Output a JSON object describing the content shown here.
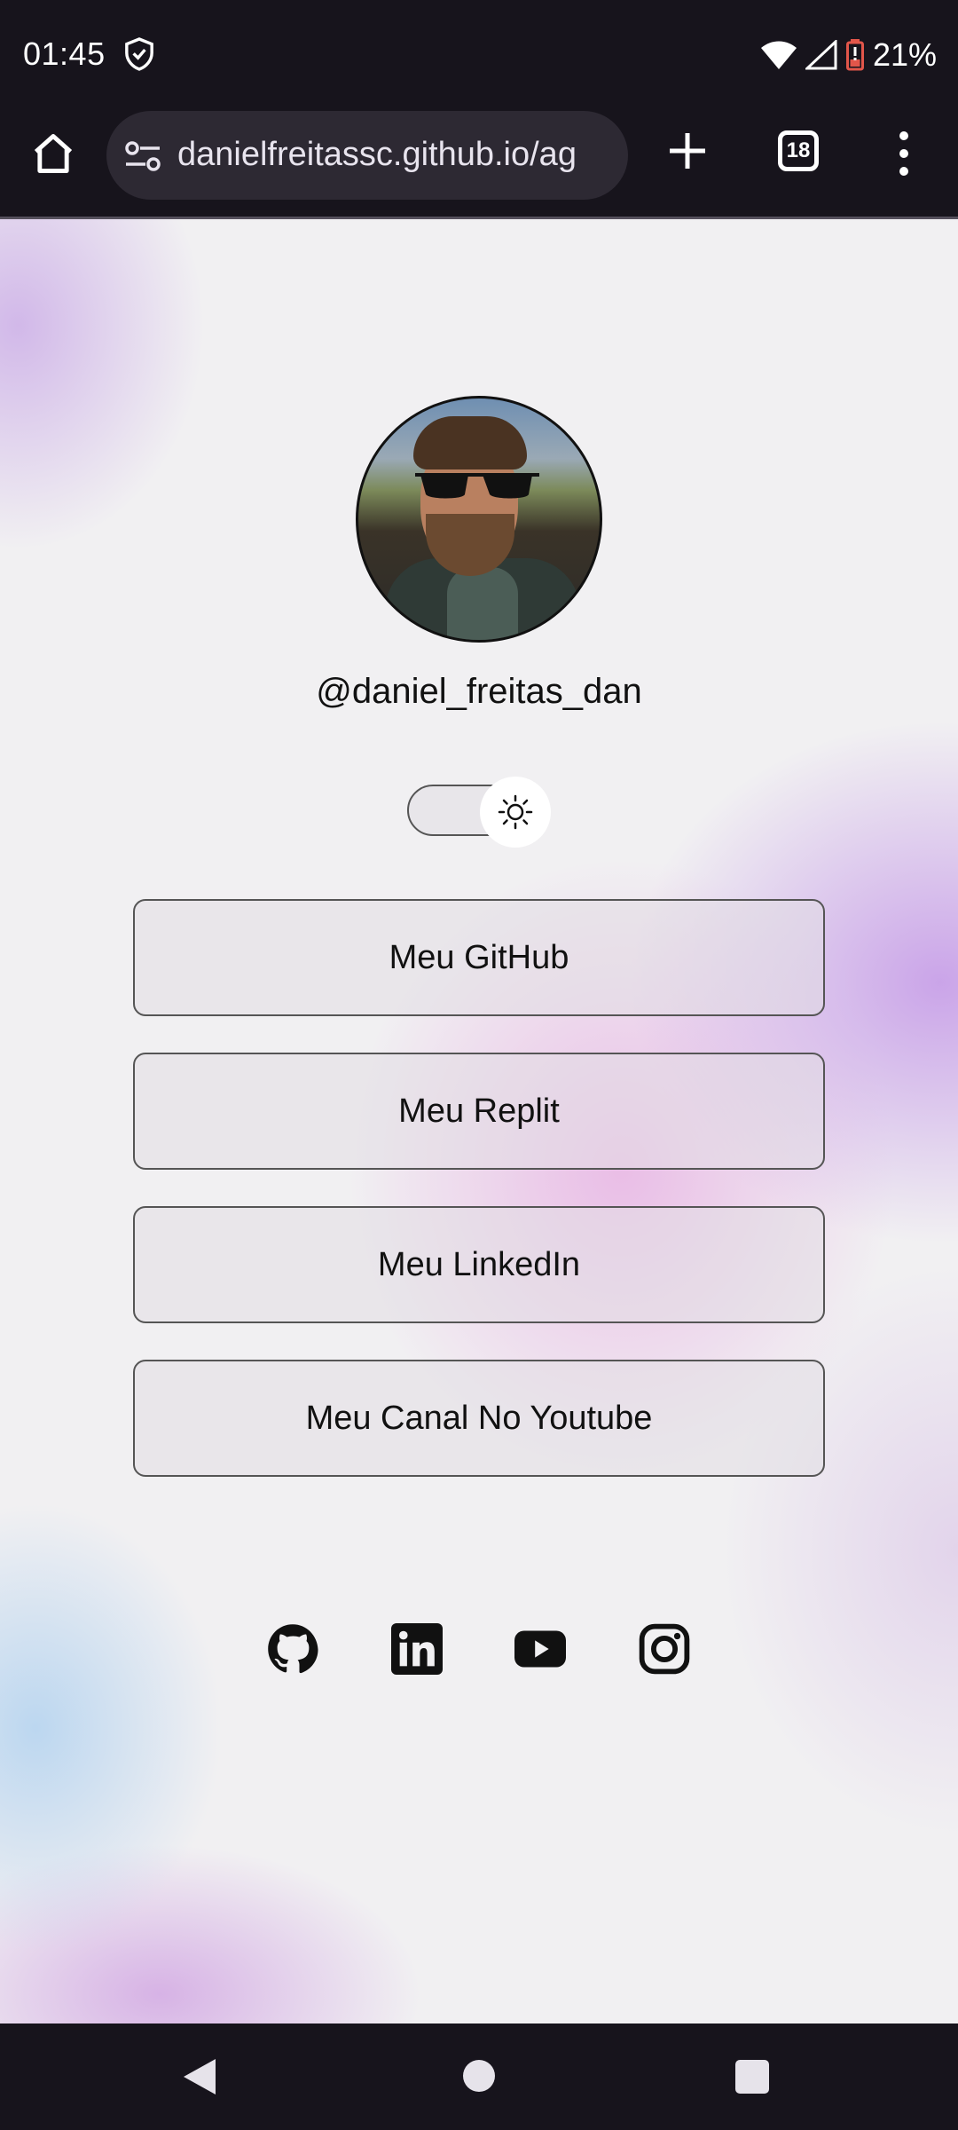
{
  "status_bar": {
    "time": "01:45",
    "battery": "21%"
  },
  "browser": {
    "url": "danielfreitassc.github.io/ag",
    "tab_count": "18"
  },
  "profile": {
    "username": "@daniel_freitas_dan"
  },
  "theme_toggle": {
    "mode": "light"
  },
  "links": [
    {
      "label": "Meu GitHub"
    },
    {
      "label": "Meu Replit"
    },
    {
      "label": "Meu LinkedIn"
    },
    {
      "label": "Meu Canal No Youtube"
    }
  ],
  "social_icons": [
    "github-icon",
    "linkedin-icon",
    "youtube-icon",
    "instagram-icon"
  ]
}
